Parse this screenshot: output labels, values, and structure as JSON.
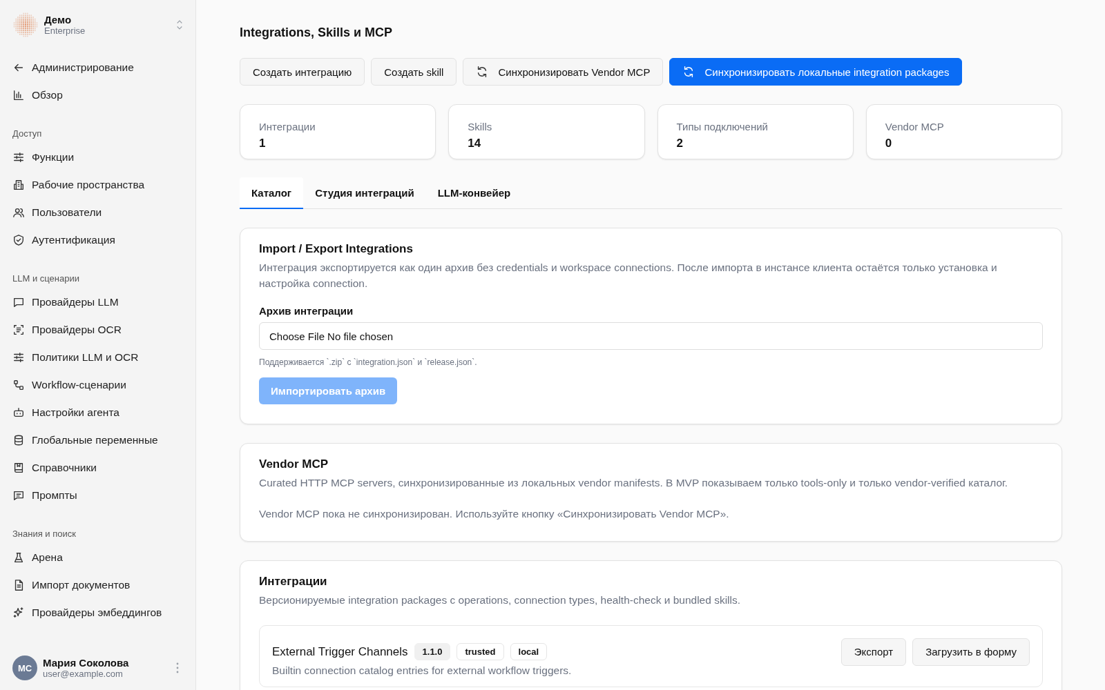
{
  "sidebar": {
    "org": {
      "name": "Демо",
      "plan": "Enterprise"
    },
    "top_items": [
      {
        "label": "Администрирование",
        "kind": "back"
      },
      {
        "label": "Обзор",
        "kind": "chart"
      }
    ],
    "groups": [
      {
        "title": "Доступ",
        "items": [
          {
            "label": "Функции",
            "kind": "sliders"
          },
          {
            "label": "Рабочие пространства",
            "kind": "building"
          },
          {
            "label": "Пользователи",
            "kind": "users"
          },
          {
            "label": "Аутентификация",
            "kind": "shield"
          }
        ]
      },
      {
        "title": "LLM и сценарии",
        "items": [
          {
            "label": "Провайдеры LLM",
            "kind": "chat"
          },
          {
            "label": "Провайдеры OCR",
            "kind": "scan"
          },
          {
            "label": "Политики LLM и OCR",
            "kind": "sliders"
          },
          {
            "label": "Workflow-сценарии",
            "kind": "flow"
          },
          {
            "label": "Настройки агента",
            "kind": "bot"
          },
          {
            "label": "Глобальные переменные",
            "kind": "db"
          },
          {
            "label": "Справочники",
            "kind": "book"
          },
          {
            "label": "Промпты",
            "kind": "prompt"
          }
        ]
      },
      {
        "title": "Знания и поиск",
        "items": [
          {
            "label": "Арена",
            "kind": "flask"
          },
          {
            "label": "Импорт документов",
            "kind": "doc"
          },
          {
            "label": "Провайдеры эмбеддингов",
            "kind": "sparkle"
          }
        ]
      }
    ],
    "user": {
      "initials": "MC",
      "name": "Мария Соколова",
      "email": "user@example.com"
    }
  },
  "page": {
    "title": "Integrations, Skills и MCP",
    "actions": [
      {
        "label": "Создать интеграцию",
        "kind": "plain"
      },
      {
        "label": "Создать skill",
        "kind": "plain"
      },
      {
        "label": "Синхронизировать Vendor MCP",
        "kind": "sync"
      },
      {
        "label": "Синхронизировать локальные integration packages",
        "kind": "primary"
      }
    ],
    "stats": [
      {
        "label": "Интеграции",
        "value": "1"
      },
      {
        "label": "Skills",
        "value": "14"
      },
      {
        "label": "Типы подключений",
        "value": "2"
      },
      {
        "label": "Vendor MCP",
        "value": "0"
      }
    ],
    "tabs": [
      {
        "label": "Каталог",
        "selected": true
      },
      {
        "label": "Студия интеграций",
        "selected": false
      },
      {
        "label": "LLM-конвейер",
        "selected": false
      }
    ],
    "import_card": {
      "title": "Import / Export Integrations",
      "description": "Интеграция экспортируется как один архив без credentials и workspace connections. После импорта в инстансе клиента остаётся только установка и настройка connection.",
      "field_label": "Архив интеграции",
      "file_button": "Choose File",
      "file_status": "No file chosen",
      "hint": "Поддерживается `.zip` с `integration.json` и `release.json`.",
      "button": {
        "label": "Импортировать архив",
        "disabled": true
      }
    },
    "vendor_card": {
      "title": "Vendor MCP",
      "description": "Curated HTTP MCP servers, синхронизированные из локальных vendor manifests. В MVP показываем только tools-only и только vendor-verified каталог.",
      "empty": "Vendor MCP пока не синхронизирован. Используйте кнопку «Синхронизировать Vendor MCP»."
    },
    "integrations_card": {
      "title": "Интеграции",
      "description": "Версионируемые integration packages с operations, connection types, health-check и bundled skills.",
      "items": [
        {
          "name": "External Trigger Channels",
          "version": "1.1.0",
          "tags": [
            "trusted",
            "local"
          ],
          "description": "Builtin connection catalog entries for external workflow triggers.",
          "actions": [
            "Экспорт",
            "Загрузить в форму"
          ]
        }
      ]
    }
  }
}
